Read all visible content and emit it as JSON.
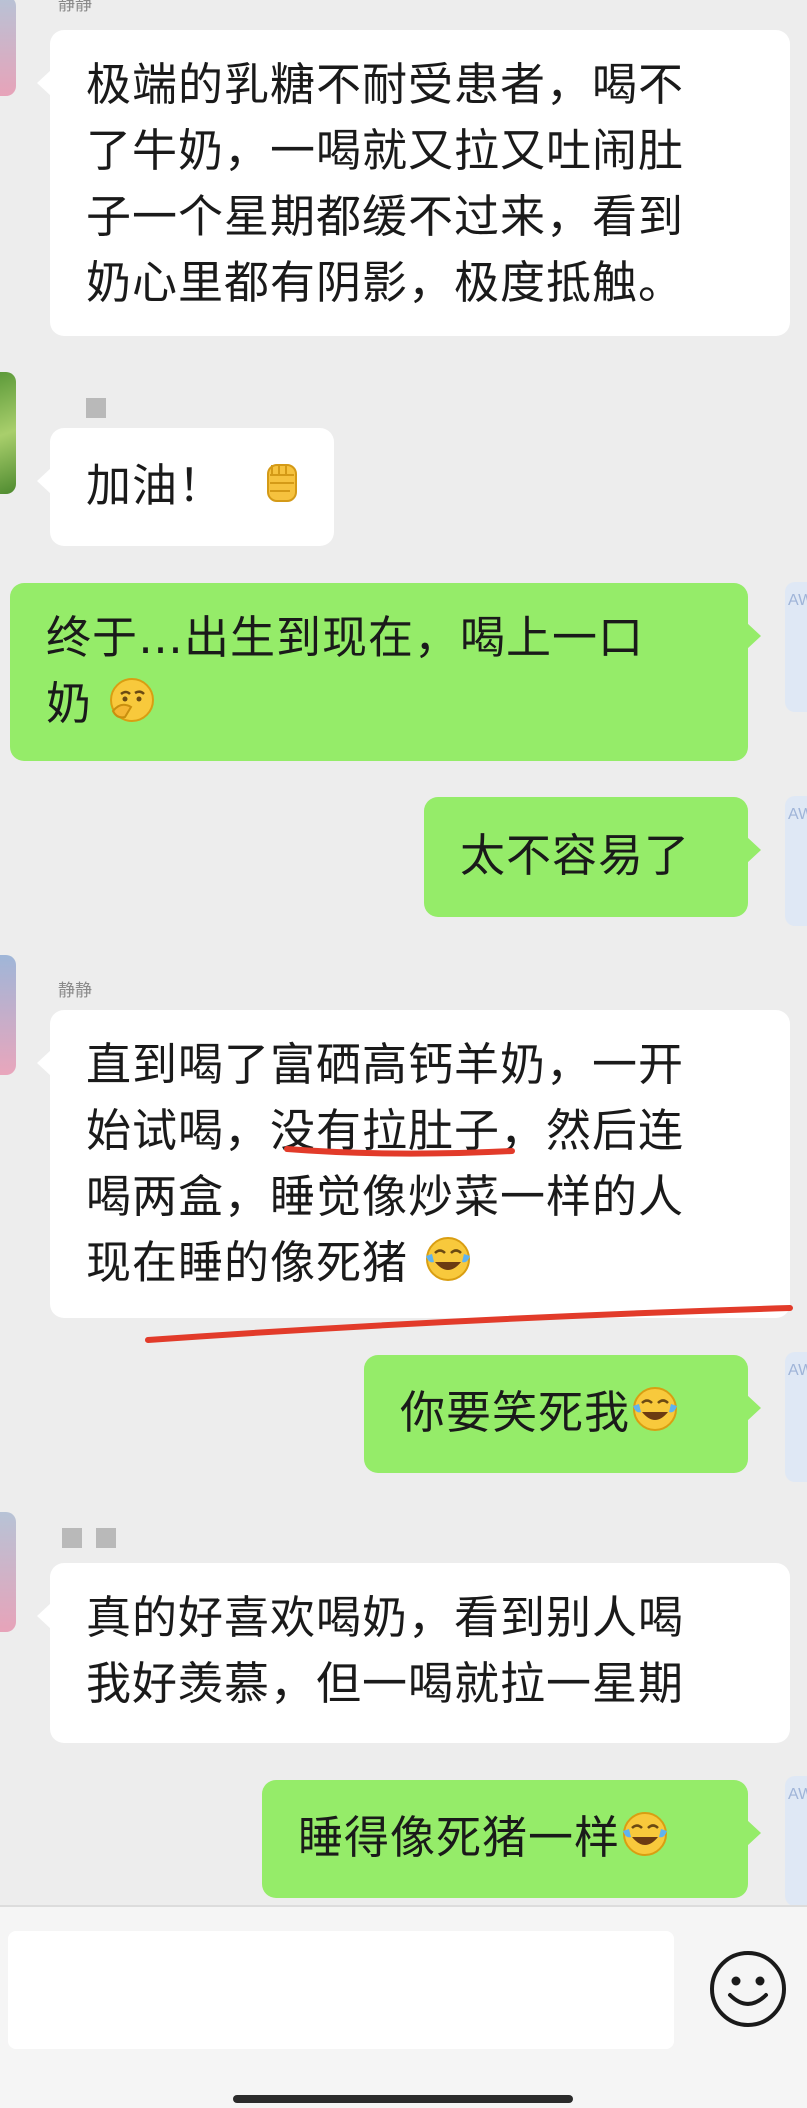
{
  "messages": [
    {
      "type": "in",
      "name": "静静",
      "text": "极端的乳糖不耐受患者，喝不了牛奶，一喝就又拉又吐闹肚子一个星期都缓不过来，看到奶心里都有阴影，极度抵触。",
      "lines": [
        "极端的乳糖不耐受患者，喝不",
        "了牛奶，一喝就又拉又吐闹肚",
        "子一个星期都缓不过来，看到",
        "奶心里都有阴影，极度抵触。"
      ]
    },
    {
      "type": "in",
      "text": "加油！",
      "emoji": "fist-emoji"
    },
    {
      "type": "out",
      "text": "终于…出生到现在，喝上一口奶",
      "lines": [
        "终于…出生到现在，喝上一口",
        "奶"
      ],
      "emoji": "thinking-emoji"
    },
    {
      "type": "out",
      "text": "太不容易了"
    },
    {
      "type": "in",
      "name": "静静",
      "text": "直到喝了富硒高钙羊奶，一开始试喝，没有拉肚子，然后连喝两盒，睡觉像炒菜一样的人现在睡的像死猪",
      "lines": [
        "直到喝了富硒高钙羊奶，一开",
        "始试喝，没有拉肚子，然后连",
        "喝两盒，睡觉像炒菜一样的人",
        "现在睡的像死猪"
      ],
      "emoji": "tears-of-joy-emoji",
      "underline": "没有拉肚子"
    },
    {
      "type": "out",
      "text": "你要笑死我",
      "emoji": "tears-of-joy-emoji"
    },
    {
      "type": "in",
      "text": "真的好喜欢喝奶，看到别人喝我好羡慕，但一喝就拉一星期",
      "lines": [
        "真的好喜欢喝奶，看到别人喝",
        "我好羡慕，但一喝就拉一星期"
      ]
    },
    {
      "type": "out",
      "text": "睡得像死猪一样",
      "emoji": "tears-of-joy-emoji"
    }
  ],
  "input": {
    "placeholder": ""
  },
  "icons": {
    "emoji_button": "smiley-face-icon"
  },
  "colors": {
    "outgoing_bubble": "#95ec69",
    "incoming_bubble": "#ffffff",
    "background": "#ededed",
    "annotation_line": "#e23b2a"
  }
}
